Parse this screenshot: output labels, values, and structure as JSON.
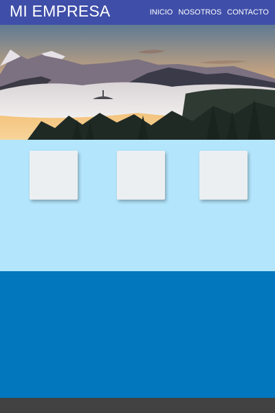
{
  "header": {
    "brand": "MI EMPRESA",
    "nav": [
      "INICIO",
      "NOSOTROS",
      "CONTACTO"
    ]
  },
  "hero": {
    "image": "mountain-landscape-with-fog-at-sunrise"
  },
  "features": {
    "cards": [
      {},
      {},
      {}
    ]
  },
  "colors": {
    "header": "#3f4ea8",
    "features_bg": "#b3e5fc",
    "card": "#eceff1",
    "content_bg": "#0277bd",
    "footer": "#424242"
  }
}
